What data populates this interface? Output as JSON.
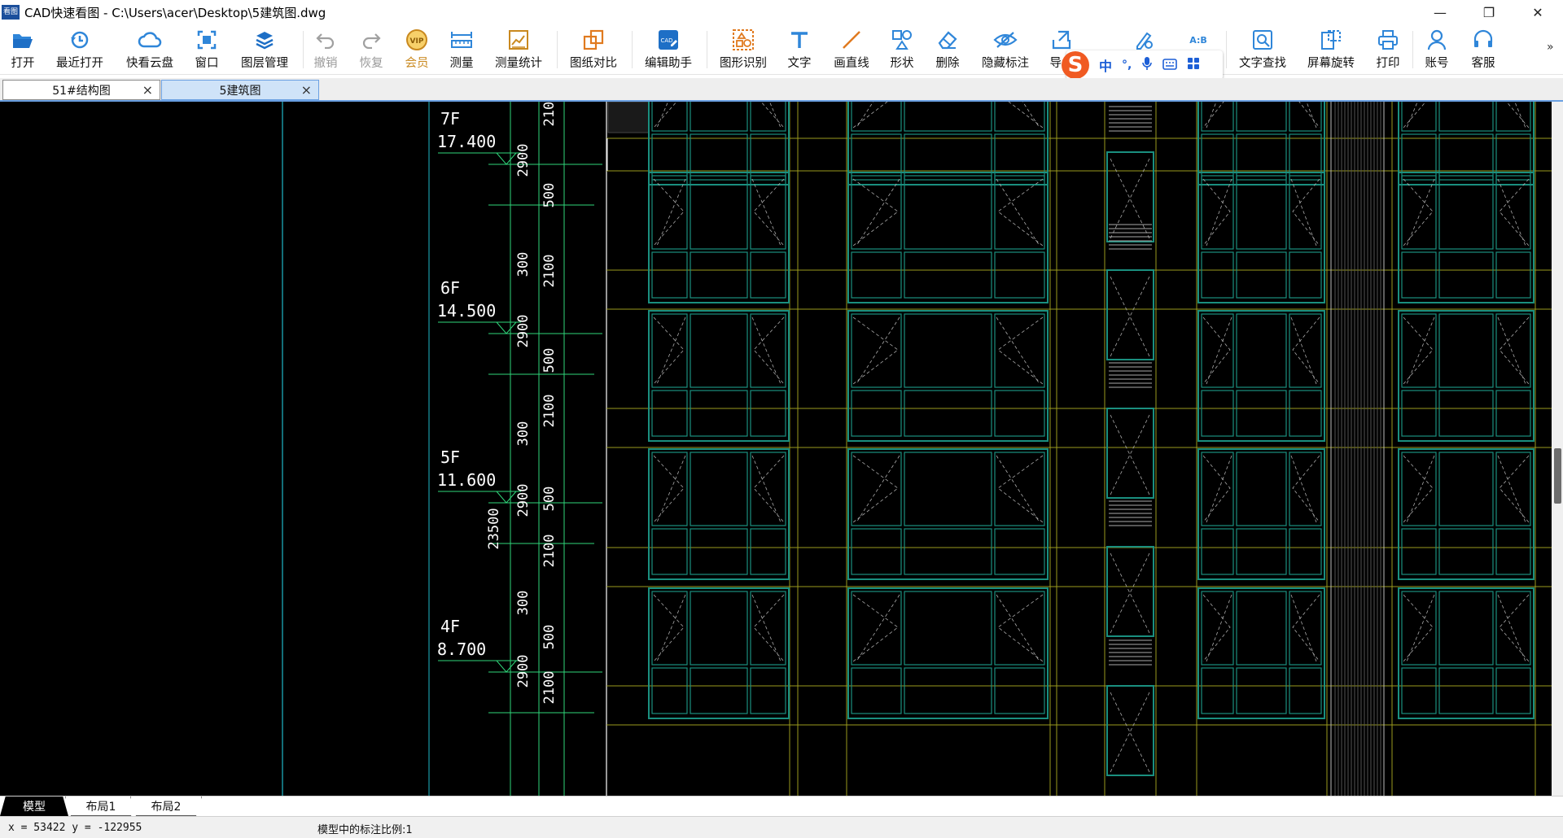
{
  "window": {
    "title": "CAD快速看图 - C:\\Users\\acer\\Desktop\\5建筑图.dwg",
    "app_icon_text": "看图"
  },
  "toolbar": {
    "buttons": [
      {
        "label": "打开",
        "icon": "folder-open-icon"
      },
      {
        "label": "最近打开",
        "icon": "recent-clock-icon"
      },
      {
        "label": "快看云盘",
        "icon": "cloud-icon"
      },
      {
        "label": "窗口",
        "icon": "window-focus-icon"
      },
      {
        "label": "图层管理",
        "icon": "layers-icon"
      },
      {
        "label": "撤销",
        "icon": "undo-icon"
      },
      {
        "label": "恢复",
        "icon": "redo-icon"
      },
      {
        "label": "会员",
        "icon": "vip-badge-icon"
      },
      {
        "label": "测量",
        "icon": "ruler-icon"
      },
      {
        "label": "测量统计",
        "icon": "measure-stats-icon"
      },
      {
        "label": "图纸对比",
        "icon": "compare-icon"
      },
      {
        "label": "编辑助手",
        "icon": "edit-assistant-icon"
      },
      {
        "label": "图形识别",
        "icon": "shape-recognize-icon"
      },
      {
        "label": "文字",
        "icon": "text-t-icon"
      },
      {
        "label": "画直线",
        "icon": "line-icon"
      },
      {
        "label": "形状",
        "icon": "shapes-icon"
      },
      {
        "label": "删除",
        "icon": "eraser-icon"
      },
      {
        "label": "隐藏标注",
        "icon": "eye-hide-icon"
      },
      {
        "label": "导入",
        "icon": "import-icon"
      },
      {
        "label": "文字查找",
        "icon": "text-search-icon"
      },
      {
        "label": "屏幕旋转",
        "icon": "rotate-screen-icon"
      },
      {
        "label": "打印",
        "icon": "printer-icon"
      },
      {
        "label": "账号",
        "icon": "user-icon"
      },
      {
        "label": "客服",
        "icon": "headset-icon"
      }
    ],
    "overflow": "»",
    "hidden_icon_text": "A:B"
  },
  "ime": {
    "logo": "S",
    "mode": "中",
    "punct": "°,"
  },
  "doc_tabs": [
    {
      "label": "51#结构图",
      "active": false
    },
    {
      "label": "5建筑图",
      "active": true
    }
  ],
  "drawing": {
    "floors": [
      {
        "name": "7F",
        "elevation": "17.400"
      },
      {
        "name": "6F",
        "elevation": "14.500"
      },
      {
        "name": "5F",
        "elevation": "11.600"
      },
      {
        "name": "4F",
        "elevation": "8.700"
      }
    ],
    "dims_a": [
      "2900",
      "300",
      "2900",
      "300",
      "2900",
      "300",
      "2900"
    ],
    "dims_b": [
      "2100",
      "500",
      "2100",
      "500",
      "2100",
      "500",
      "2100",
      "500",
      "2100"
    ],
    "total_dim": "23500",
    "colors": {
      "green": "#2fd67a",
      "yellow": "#9a9a1e",
      "teal": "#1a8f7f",
      "white": "#ffffff",
      "cyan": "#20b8c8"
    }
  },
  "layout_tabs": [
    {
      "label": "模型",
      "active": true
    },
    {
      "label": "布局1",
      "active": false
    },
    {
      "label": "布局2",
      "active": false
    }
  ],
  "status": {
    "coords": "x = 53422  y = -122955",
    "scale_text": "模型中的标注比例:1"
  }
}
